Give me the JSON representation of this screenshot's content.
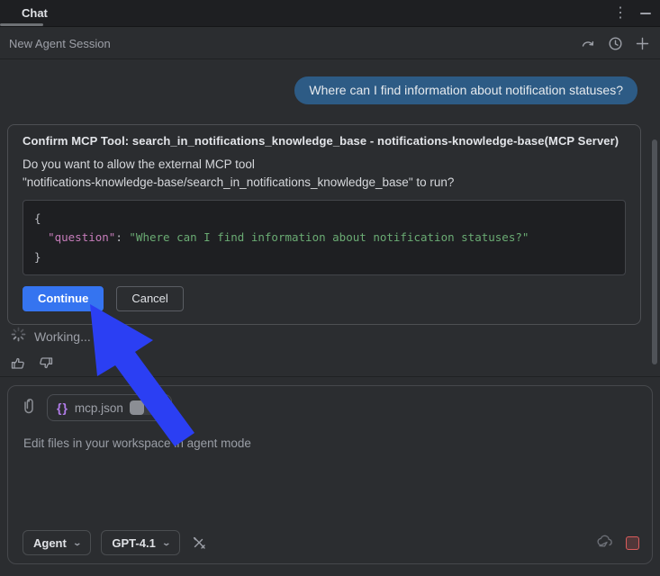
{
  "window": {
    "tab_label": "Chat"
  },
  "toolbar": {
    "title": "New Agent Session"
  },
  "icons": {
    "kebab": "⋮",
    "plus_glyph": "+",
    "chevron_down": "⌄",
    "json_braces": "{}"
  },
  "chat": {
    "user_message": "Where can I find information about notification statuses?",
    "confirm_card": {
      "title": "Confirm MCP Tool: search_in_notifications_knowledge_base - notifications-knowledge-base(MCP Server)",
      "body_line1": "Do you want to allow the external MCP tool",
      "body_line2": "\"notifications-knowledge-base/search_in_notifications_knowledge_base\" to run?",
      "code": {
        "open_brace": "{",
        "indent": "  ",
        "key": "\"question\"",
        "separator": ": ",
        "value": "\"Where can I find information about notification statuses?\"",
        "close_brace": "}"
      },
      "continue_label": "Continue",
      "cancel_label": "Cancel"
    },
    "status_text": "Working..."
  },
  "composer": {
    "attachment_file": "mcp.json",
    "placeholder": "Edit files in your workspace in agent mode",
    "mode_selector": "Agent",
    "model_selector": "GPT-4.1"
  },
  "colors": {
    "accent_blue": "#3574f0",
    "user_bubble": "#2d5b85",
    "annotation_arrow": "#2b3ff3",
    "code_key_pink": "#c77dbb",
    "code_string_green": "#6aab73",
    "stop_red": "#db5c5c",
    "panel_bg": "#2b2d30",
    "titlebar_bg": "#1e1f22"
  }
}
